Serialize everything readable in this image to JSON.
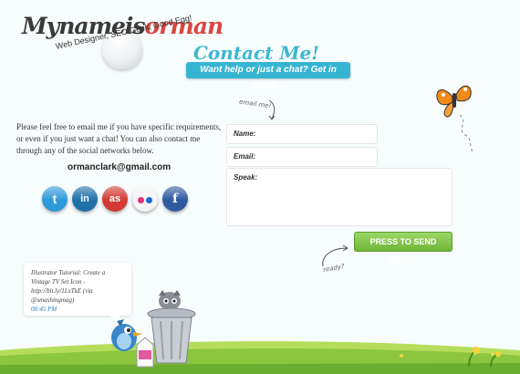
{
  "logo": {
    "name_part1": "Mynameis",
    "name_part2": "orman",
    "tagline": "Web Designer, SEO Geek, Good Egg!"
  },
  "header": {
    "title": "Contact Me!",
    "subtitle": "Want help or just a chat? Get in touch..."
  },
  "intro": {
    "text": "Please feel free to email me if you have specific requirements, or even if you just want a chat! You can also contact me through any of the social networks below.",
    "email": "ormanclark@gmail.com"
  },
  "social": {
    "twitter_glyph": "t",
    "linkedin_glyph": "in",
    "lastfm_glyph": "as",
    "facebook_glyph": "f",
    "icons": [
      "twitter-icon",
      "linkedin-icon",
      "lastfm-icon",
      "flickr-icon",
      "facebook-icon"
    ]
  },
  "form": {
    "note_email": "email me!",
    "name_label": "Name:",
    "email_label": "Email:",
    "speak_label": "Speak:",
    "send_label": "PRESS TO SEND EMAIL!",
    "note_ready": "ready?"
  },
  "tweet": {
    "text": "Illustrator Tutorial: Create a Vintage TV Set Icon - http://bit.ly/1LxTkE (via @smashingmag)",
    "time": "08:45 PM"
  },
  "colors": {
    "accent": "#35b5d2",
    "send_button": "#7cc443",
    "logo_red": "#d9473e"
  }
}
